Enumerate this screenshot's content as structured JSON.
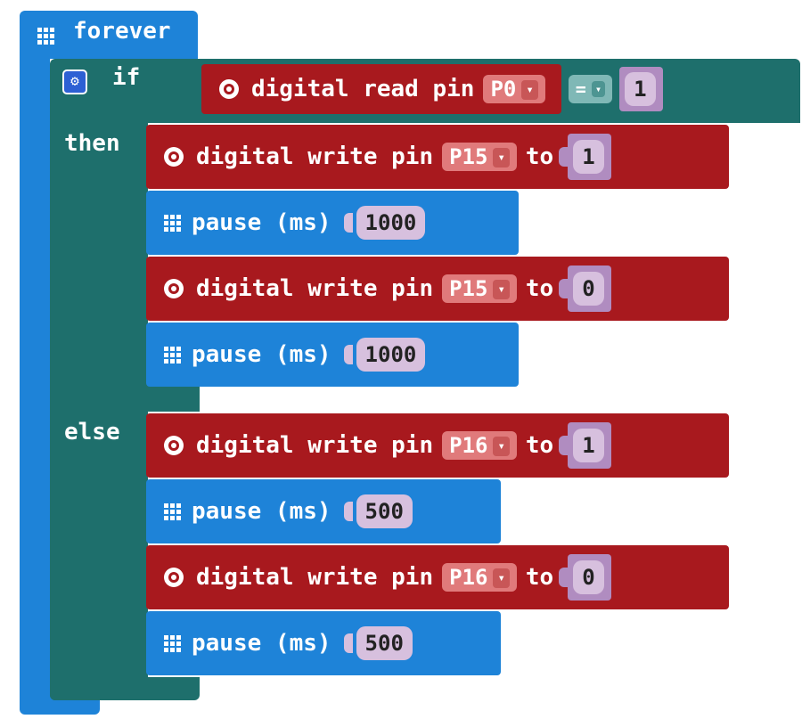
{
  "forever": {
    "label": "forever",
    "icon": "grid-icon"
  },
  "if_block": {
    "if_label": "if",
    "then_label": "then",
    "else_label": "else",
    "condition": {
      "read_label": "digital read pin",
      "pin": "P0",
      "operator": "=",
      "value": "1"
    }
  },
  "then_blocks": [
    {
      "type": "digital_write",
      "label": "digital write pin",
      "pin": "P15",
      "to_label": "to",
      "value": "1"
    },
    {
      "type": "pause",
      "label": "pause (ms)",
      "value": "1000"
    },
    {
      "type": "digital_write",
      "label": "digital write pin",
      "pin": "P15",
      "to_label": "to",
      "value": "0"
    },
    {
      "type": "pause",
      "label": "pause (ms)",
      "value": "1000"
    }
  ],
  "else_blocks": [
    {
      "type": "digital_write",
      "label": "digital write pin",
      "pin": "P16",
      "to_label": "to",
      "value": "1"
    },
    {
      "type": "pause",
      "label": "pause (ms)",
      "value": "500"
    },
    {
      "type": "digital_write",
      "label": "digital write pin",
      "pin": "P16",
      "to_label": "to",
      "value": "0"
    },
    {
      "type": "pause",
      "label": "pause (ms)",
      "value": "500"
    }
  ],
  "colors": {
    "basic_blue": "#1e83d8",
    "logic_teal": "#1e6f6c",
    "pins_red": "#a8191e",
    "math_purple": "#b08cc0"
  }
}
